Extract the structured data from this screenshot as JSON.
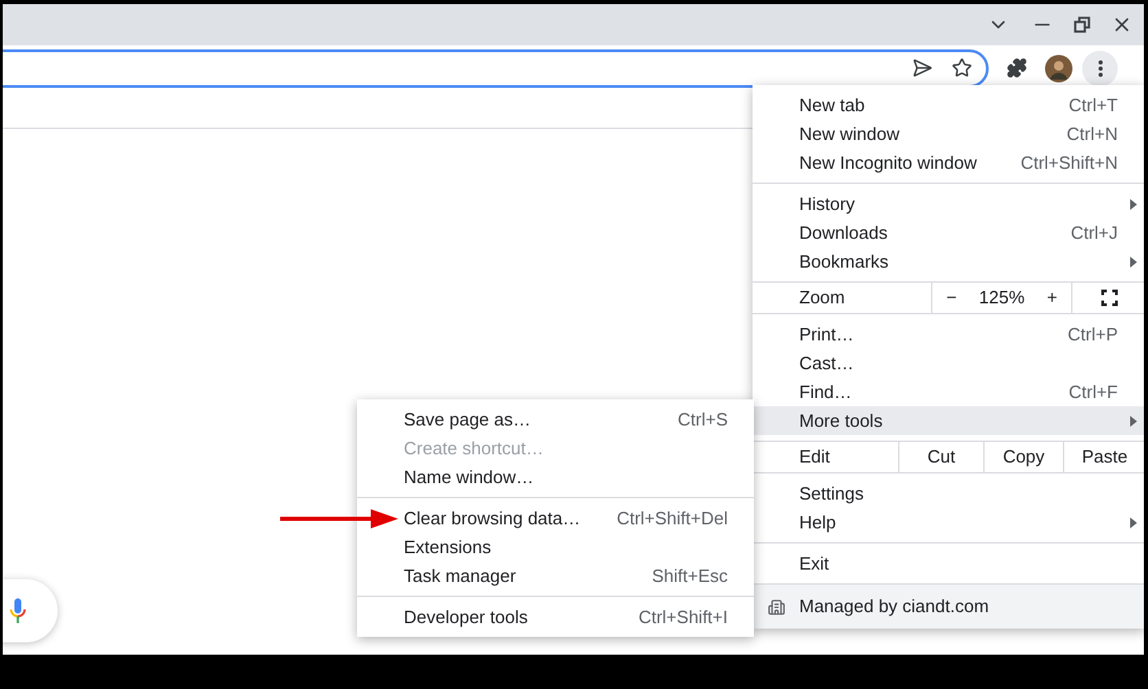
{
  "menu": {
    "sections": [
      {
        "kind": "items",
        "items": [
          {
            "label": "New tab",
            "shortcut": "Ctrl+T",
            "submenu": false,
            "selected": false
          },
          {
            "label": "New window",
            "shortcut": "Ctrl+N",
            "submenu": false,
            "selected": false
          },
          {
            "label": "New Incognito window",
            "shortcut": "Ctrl+Shift+N",
            "submenu": false,
            "selected": false
          }
        ]
      },
      {
        "kind": "items",
        "items": [
          {
            "label": "History",
            "submenu": true,
            "selected": false
          },
          {
            "label": "Downloads",
            "shortcut": "Ctrl+J",
            "submenu": false,
            "selected": false
          },
          {
            "label": "Bookmarks",
            "submenu": true,
            "selected": false
          }
        ]
      },
      {
        "kind": "zoom",
        "label": "Zoom",
        "minus": "−",
        "value": "125%",
        "plus": "+"
      },
      {
        "kind": "items",
        "items": [
          {
            "label": "Print…",
            "shortcut": "Ctrl+P",
            "submenu": false,
            "selected": false
          },
          {
            "label": "Cast…",
            "submenu": false,
            "selected": false
          },
          {
            "label": "Find…",
            "shortcut": "Ctrl+F",
            "submenu": false,
            "selected": false
          },
          {
            "label": "More tools",
            "submenu": true,
            "selected": true
          }
        ]
      },
      {
        "kind": "edit",
        "label": "Edit",
        "actions": [
          "Cut",
          "Copy",
          "Paste"
        ]
      },
      {
        "kind": "items",
        "items": [
          {
            "label": "Settings",
            "submenu": false,
            "selected": false
          },
          {
            "label": "Help",
            "submenu": true,
            "selected": false
          }
        ]
      },
      {
        "kind": "items",
        "items": [
          {
            "label": "Exit",
            "submenu": false,
            "selected": false
          }
        ]
      },
      {
        "kind": "managed",
        "label": "Managed by ciandt.com"
      }
    ]
  },
  "submenu": {
    "sections": [
      {
        "kind": "items",
        "items": [
          {
            "label": "Save page as…",
            "shortcut": "Ctrl+S",
            "disabled": false
          },
          {
            "label": "Create shortcut…",
            "disabled": true
          },
          {
            "label": "Name window…",
            "disabled": false
          }
        ]
      },
      {
        "kind": "items",
        "items": [
          {
            "label": "Clear browsing data…",
            "shortcut": "Ctrl+Shift+Del",
            "disabled": false
          },
          {
            "label": "Extensions",
            "disabled": false
          },
          {
            "label": "Task manager",
            "shortcut": "Shift+Esc",
            "disabled": false
          }
        ]
      },
      {
        "kind": "items",
        "items": [
          {
            "label": "Developer tools",
            "shortcut": "Ctrl+Shift+I",
            "disabled": false
          }
        ]
      }
    ]
  }
}
